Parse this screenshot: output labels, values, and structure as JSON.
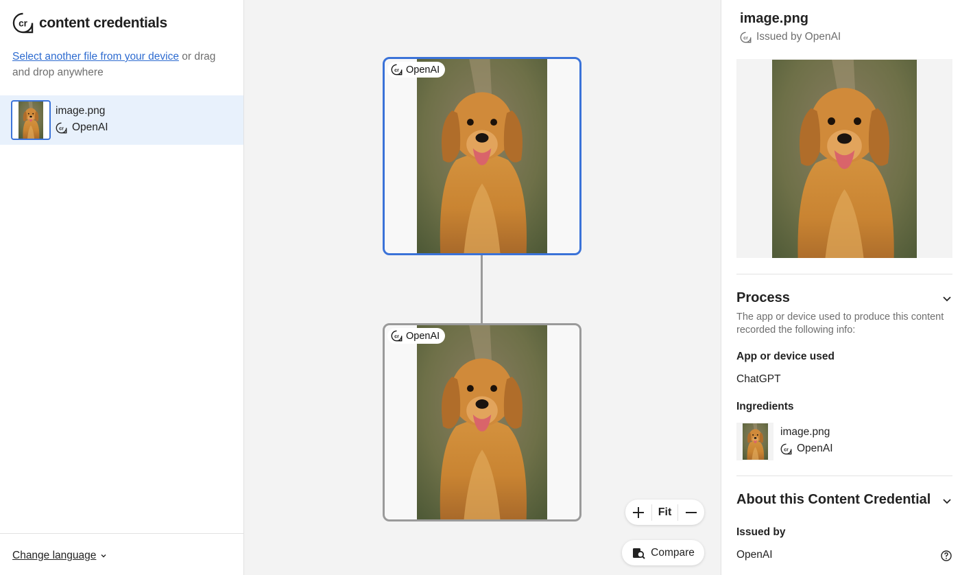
{
  "app": {
    "name": "content credentials"
  },
  "sidebar": {
    "select_link": "Select another file from your device",
    "select_rest": " or drag and drop anywhere",
    "file": {
      "name": "image.png",
      "issuer": "OpenAI"
    },
    "change_language": "Change language"
  },
  "canvas": {
    "nodes": [
      {
        "badge": "OpenAI"
      },
      {
        "badge": "OpenAI"
      }
    ],
    "zoom_fit": "Fit",
    "compare": "Compare"
  },
  "details": {
    "title": "image.png",
    "issued_by": "Issued by OpenAI",
    "process": {
      "title": "Process",
      "description": "The app or device used to produce this content recorded the following info:",
      "app_label": "App or device used",
      "app_value": "ChatGPT",
      "ingredients_label": "Ingredients",
      "ingredient": {
        "name": "image.png",
        "issuer": "OpenAI"
      }
    },
    "about": {
      "title": "About this Content Credential",
      "issued_by_label": "Issued by",
      "issued_by_value": "OpenAI"
    }
  },
  "colors": {
    "accent": "#3a72d8",
    "link": "#2d6bd0",
    "selected_bg": "#e8f1fc"
  }
}
